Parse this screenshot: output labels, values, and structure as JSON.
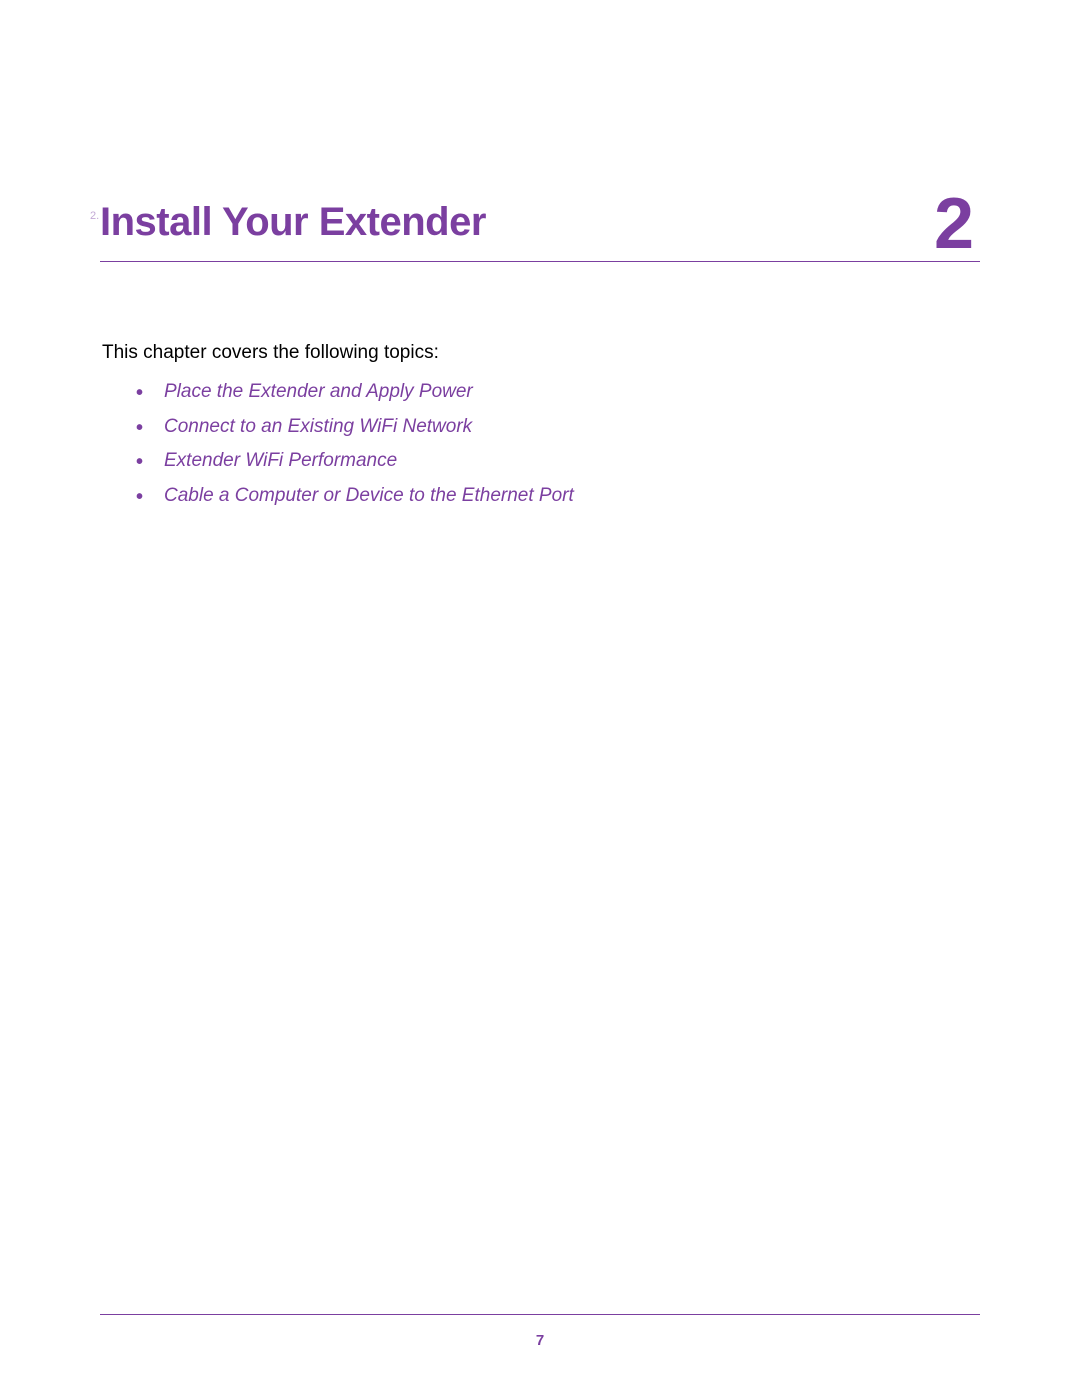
{
  "chapter": {
    "marker": "2.",
    "title": "Install Your Extender",
    "number": "2"
  },
  "intro": "This chapter covers the following topics:",
  "topics": [
    "Place the Extender and Apply Power",
    "Connect to an Existing WiFi Network",
    "Extender WiFi Performance",
    "Cable a Computer or Device to the Ethernet Port"
  ],
  "page_number": "7"
}
